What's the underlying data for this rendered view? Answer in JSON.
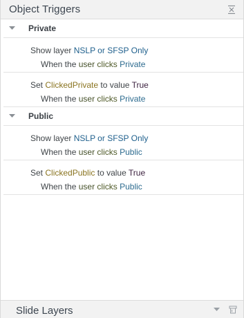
{
  "panel": {
    "title": "Object Triggers",
    "collapse_icon": "collapse-icon"
  },
  "groups": [
    {
      "label": "Private",
      "triggers": [
        {
          "action": "Show layer",
          "target": "NSLP or SFSP Only",
          "when": "When the",
          "user": "user",
          "event": "clicks",
          "object": "Private"
        },
        {
          "action": "Set",
          "variable": "ClickedPrivate",
          "to_value": "to value",
          "value": "True",
          "when": "When the",
          "user": "user",
          "event": "clicks",
          "object": "Private"
        }
      ]
    },
    {
      "label": "Public",
      "triggers": [
        {
          "action": "Show layer",
          "target": "NSLP or SFSP Only",
          "when": "When the",
          "user": "user",
          "event": "clicks",
          "object": "Public"
        },
        {
          "action": "Set",
          "variable": "ClickedPublic",
          "to_value": "to value",
          "value": "True",
          "when": "When the",
          "user": "user",
          "event": "clicks",
          "object": "Public"
        }
      ]
    }
  ],
  "footer": {
    "title": "Slide Layers",
    "icons": [
      "dropdown-arrow-icon",
      "panel-pin-icon"
    ]
  }
}
